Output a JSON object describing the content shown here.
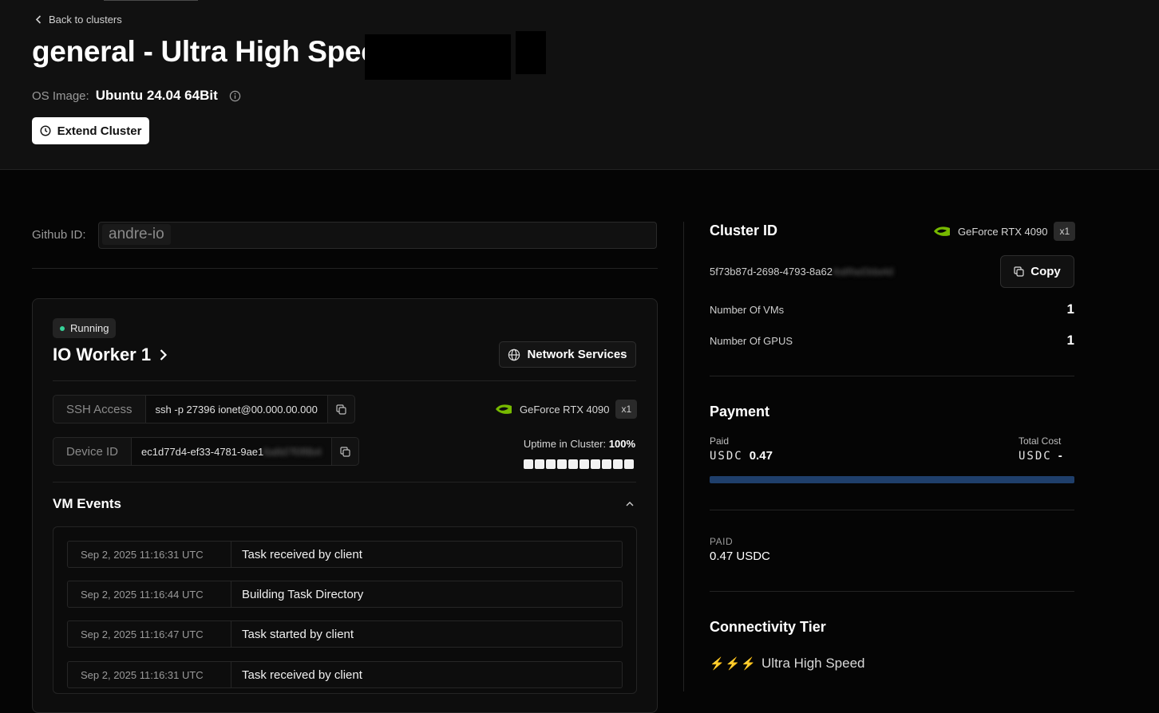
{
  "header": {
    "back_label": "Back to clusters",
    "title": "general - Ultra High Speed",
    "os_label": "OS Image:",
    "os_value": "Ubuntu 24.04 64Bit",
    "extend_label": "Extend Cluster"
  },
  "github": {
    "label": "Github ID:",
    "value": "andre-io"
  },
  "worker": {
    "status": "Running",
    "name": "IO Worker 1",
    "network_services_label": "Network Services",
    "ssh_label": "SSH Access",
    "ssh_value": "ssh -p 27396 ionet@00.000.00.000",
    "device_label": "Device ID",
    "device_value": "ec1d77d4-ef33-4781-9ae1",
    "device_value_hidden": "6a8d7f0f8b4",
    "gpu_name": "GeForce RTX 4090",
    "gpu_count": "x1",
    "uptime_label": "Uptime in Cluster:",
    "uptime_value": "100%",
    "uptime_bars": 10
  },
  "vm_events": {
    "title": "VM Events",
    "events": [
      {
        "time": "Sep 2, 2025 11:16:31 UTC",
        "message": "Task received by client"
      },
      {
        "time": "Sep 2, 2025 11:16:44 UTC",
        "message": "Building Task Directory"
      },
      {
        "time": "Sep 2, 2025 11:16:47 UTC",
        "message": "Task started by client"
      },
      {
        "time": "Sep 2, 2025 11:16:31 UTC",
        "message": "Task received by client"
      }
    ]
  },
  "cluster": {
    "id_title": "Cluster ID",
    "gpu_name": "GeForce RTX 4090",
    "gpu_count": "x1",
    "id_value": "5f73b87d-2698-4793-8a62",
    "id_value_hidden": "4a8fad3da4d",
    "copy_label": "Copy",
    "vms_label": "Number Of VMs",
    "vms_value": "1",
    "gpus_label": "Number Of GPUS",
    "gpus_value": "1"
  },
  "payment": {
    "title": "Payment",
    "paid_label": "Paid",
    "currency": "USDC",
    "paid_value": "0.47",
    "total_label": "Total Cost",
    "total_value": "-",
    "progress": 1.0,
    "progress_color": "#1f3f6b",
    "paid_caps_label": "PAID",
    "paid_caps_value": "0.47 USDC"
  },
  "connectivity": {
    "title": "Connectivity Tier",
    "bolts": "⚡⚡⚡",
    "tier": "Ultra High Speed"
  },
  "colors": {
    "accent_green": "#76b900",
    "status_green": "#36d399",
    "bolt_yellow": "#f5c400"
  }
}
